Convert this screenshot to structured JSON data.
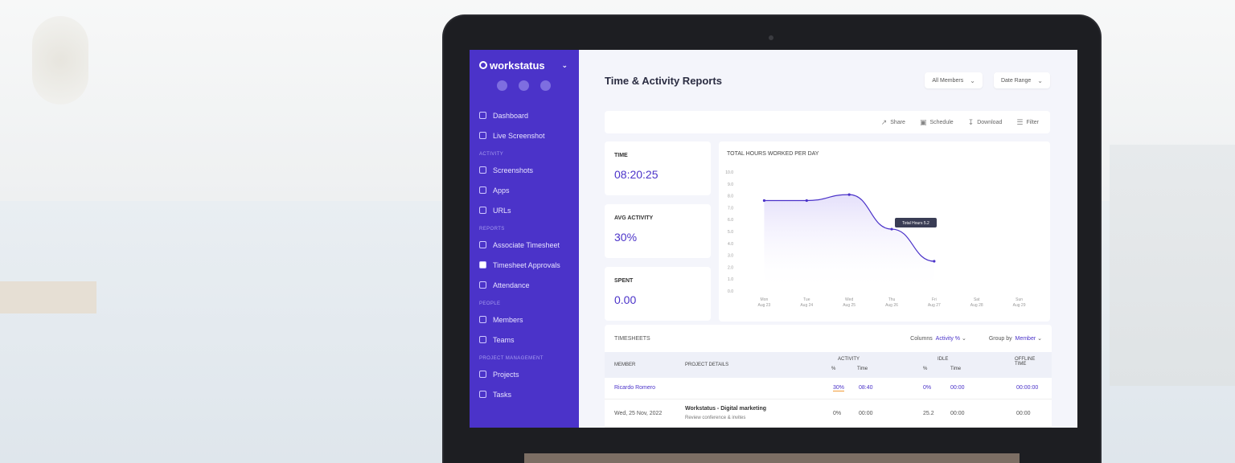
{
  "sidebar": {
    "brand": "workstatus",
    "nav_top": [
      "Dashboard",
      "Live Screenshot"
    ],
    "sections": [
      {
        "title": "ACTIVITY",
        "items": [
          "Screenshots",
          "Apps",
          "URLs"
        ]
      },
      {
        "title": "REPORTS",
        "items": [
          "Associate Timesheet",
          "Timesheet Approvals",
          "Attendance"
        ],
        "active_index": 1
      },
      {
        "title": "PEOPLE",
        "items": [
          "Members",
          "Teams"
        ]
      },
      {
        "title": "PROJECT MANAGEMENT",
        "items": [
          "Projects",
          "Tasks"
        ]
      }
    ]
  },
  "header": {
    "title": "Time & Activity Reports",
    "members_dropdown": "All Members",
    "date_dropdown": "Date Range"
  },
  "actions": [
    "Share",
    "Schedule",
    "Download",
    "Filter"
  ],
  "cards": [
    {
      "label": "TIME",
      "value": "08:20:25"
    },
    {
      "label": "AVG ACTIVITY",
      "value": "30%"
    },
    {
      "label": "SPENT",
      "value": "0.00"
    }
  ],
  "chart_data": {
    "type": "line",
    "title": "TOTAL HOURS WORKED PER DAY",
    "categories": [
      "Mon Aug 23",
      "Tue Aug 24",
      "Wed Aug 25",
      "Thu Aug 26",
      "Fri Aug 27",
      "Sat Aug 28",
      "Sun Aug 29"
    ],
    "values": [
      7.6,
      7.6,
      8.1,
      5.2,
      2.5
    ],
    "y_ticks": [
      "0.0",
      "1.0",
      "2.0",
      "3.0",
      "4.0",
      "5.0",
      "6.0",
      "7.0",
      "8.0",
      "9.0",
      "10.0"
    ],
    "ylim": [
      0,
      10
    ],
    "tooltip": "Total Hours 5.2",
    "tooltip_index": 3,
    "color": "#4b33c9"
  },
  "table": {
    "title": "TIMESHEETS",
    "filter1_label": "Columns",
    "filter1_value": "Activity %",
    "filter2_label": "Group by",
    "filter2_value": "Member",
    "columns": [
      "MEMBER",
      "PROJECT DETAILS",
      "ACTIVITY",
      "IDLE",
      "OFFLINE TIME"
    ],
    "subcolumns": [
      "%",
      "Time",
      "%",
      "Time"
    ],
    "rows": [
      {
        "member": "Ricardo Romero",
        "details": "",
        "sub": "",
        "act_pct": "30%",
        "act_time": "08:40",
        "idle_pct": "0%",
        "idle_time": "00:00",
        "offline": "00:00:00"
      },
      {
        "member": "Wed, 25 Nov, 2022",
        "details": "Workstatus - Digital marketing",
        "sub": "Review conference & invites",
        "act_pct": "0%",
        "act_time": "00:00",
        "idle_pct": "25.2",
        "idle_time": "00:00",
        "offline": "00:00"
      }
    ]
  }
}
